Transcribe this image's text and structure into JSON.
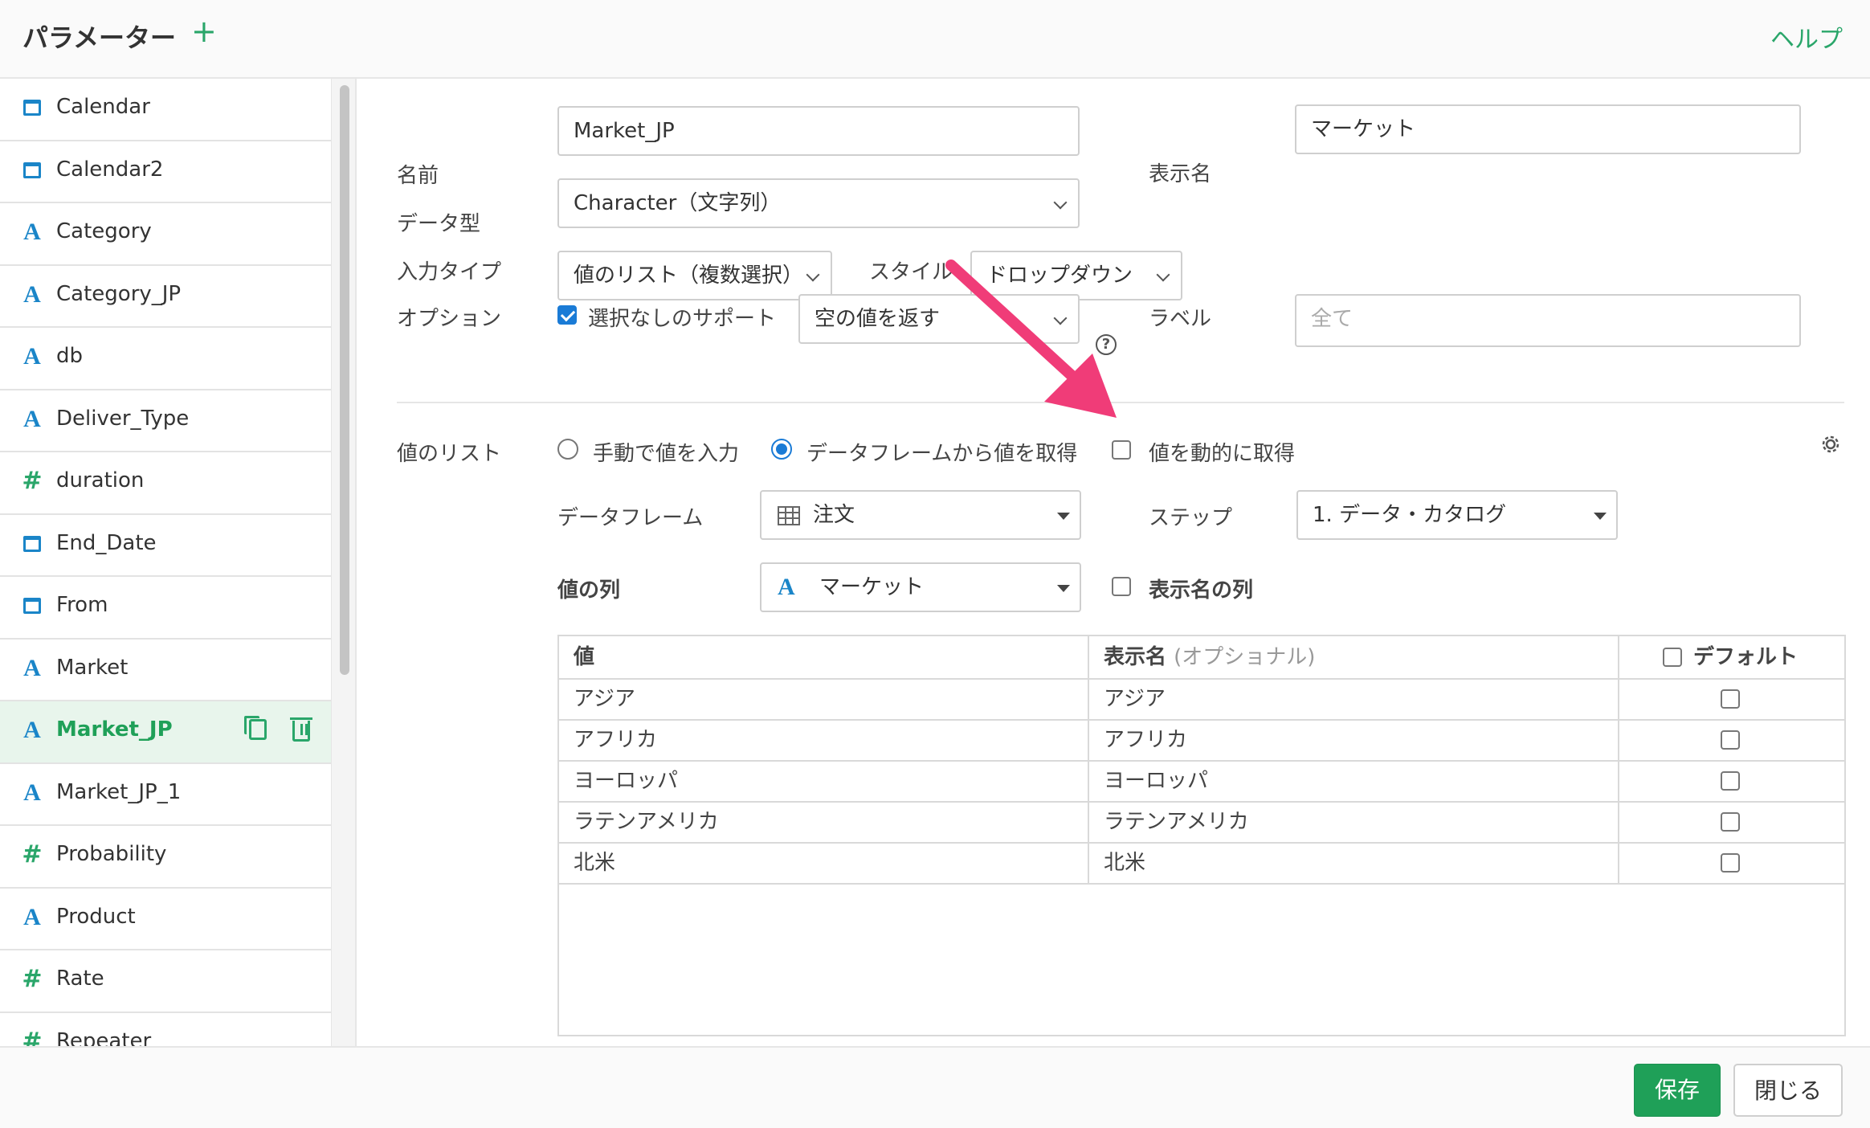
{
  "header": {
    "title": "パラメーター",
    "add_label": "+",
    "help_label": "ヘルプ"
  },
  "sidebar": {
    "items": [
      {
        "type": "calendar",
        "label": "Calendar"
      },
      {
        "type": "calendar",
        "label": "Calendar2"
      },
      {
        "type": "A",
        "label": "Category"
      },
      {
        "type": "A",
        "label": "Category_JP"
      },
      {
        "type": "A",
        "label": "db"
      },
      {
        "type": "A",
        "label": "Deliver_Type"
      },
      {
        "type": "#",
        "label": "duration"
      },
      {
        "type": "calendar",
        "label": "End_Date"
      },
      {
        "type": "calendar",
        "label": "From"
      },
      {
        "type": "A",
        "label": "Market"
      },
      {
        "type": "A",
        "label": "Market_JP",
        "active": true
      },
      {
        "type": "A",
        "label": "Market_JP_1"
      },
      {
        "type": "#",
        "label": "Probability"
      },
      {
        "type": "A",
        "label": "Product"
      },
      {
        "type": "#",
        "label": "Rate"
      },
      {
        "type": "#",
        "label": "Repeater"
      }
    ]
  },
  "form": {
    "name_label": "名前",
    "name_value": "Market_JP",
    "display_name_label": "表示名",
    "display_name_value": "マーケット",
    "datatype_label": "データ型",
    "datatype_value": "Character（文字列）",
    "input_type_label": "入力タイプ",
    "input_type_value": "値のリスト（複数選択）",
    "style_label": "スタイル",
    "style_value": "ドロップダウン",
    "option_label": "オプション",
    "option_support_none_label": "選択なしのサポート",
    "option_support_none_checked": true,
    "option_empty_value": "空の値を返す",
    "help_glyph": "?",
    "label_label": "ラベル",
    "label_placeholder": "全て"
  },
  "value_list": {
    "label": "値のリスト",
    "radio_manual": "手動で値を入力",
    "radio_dataframe": "データフレームから値を取得",
    "selected": "dataframe",
    "dynamic_label": "値を動的に取得",
    "dynamic_checked": false,
    "dataframe_label": "データフレーム",
    "dataframe_value": "注文",
    "step_label": "ステップ",
    "step_value": "1. データ・カタログ",
    "value_column_label": "値の列",
    "value_column_type": "A",
    "value_column_value": "マーケット",
    "display_column_label": "表示名の列",
    "display_column_checked": false
  },
  "table": {
    "headers": {
      "value": "値",
      "display": "表示名",
      "display_note": "(オプショナル)",
      "default": "デフォルト"
    },
    "rows": [
      {
        "value": "アジア",
        "display": "アジア",
        "default": false
      },
      {
        "value": "アフリカ",
        "display": "アフリカ",
        "default": false
      },
      {
        "value": "ヨーロッパ",
        "display": "ヨーロッパ",
        "default": false
      },
      {
        "value": "ラテンアメリカ",
        "display": "ラテンアメリカ",
        "default": false
      },
      {
        "value": "北米",
        "display": "北米",
        "default": false
      }
    ]
  },
  "footer": {
    "save_label": "保存",
    "close_label": "閉じる"
  },
  "colors": {
    "accent": "#1fa058",
    "link": "#1a85c8",
    "checkbox": "#1a7bd6",
    "annotation_arrow": "#f03c78"
  }
}
